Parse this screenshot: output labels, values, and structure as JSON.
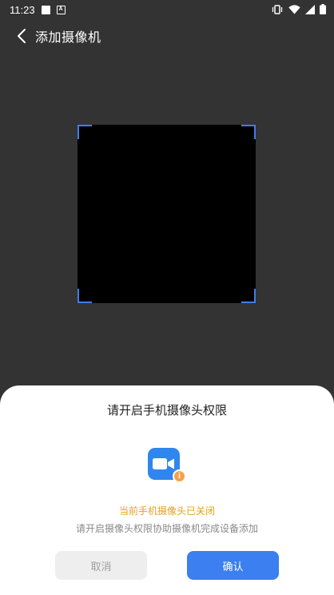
{
  "status_bar": {
    "time": "11:23",
    "icons": [
      "notification-square-icon",
      "a-badge-icon",
      "vibrate-icon",
      "wifi-icon",
      "signal-icon",
      "battery-icon"
    ]
  },
  "header": {
    "back_icon": "chevron-left-icon",
    "title": "添加摄像机"
  },
  "scanner": {
    "frame_color": "#3f7df0",
    "background": "#000000"
  },
  "dialog": {
    "title": "请开启手机摄像头权限",
    "icon": "video-camera-icon",
    "badge_icon": "info-badge-icon",
    "badge_text": "i",
    "warning_text": "当前手机摄像头已关闭",
    "description": "请开启摄像头权限协助摄像机完成设备添加",
    "cancel_label": "取消",
    "confirm_label": "确认",
    "accent_color": "#3b7ff0",
    "warning_color": "#e8a01c"
  }
}
